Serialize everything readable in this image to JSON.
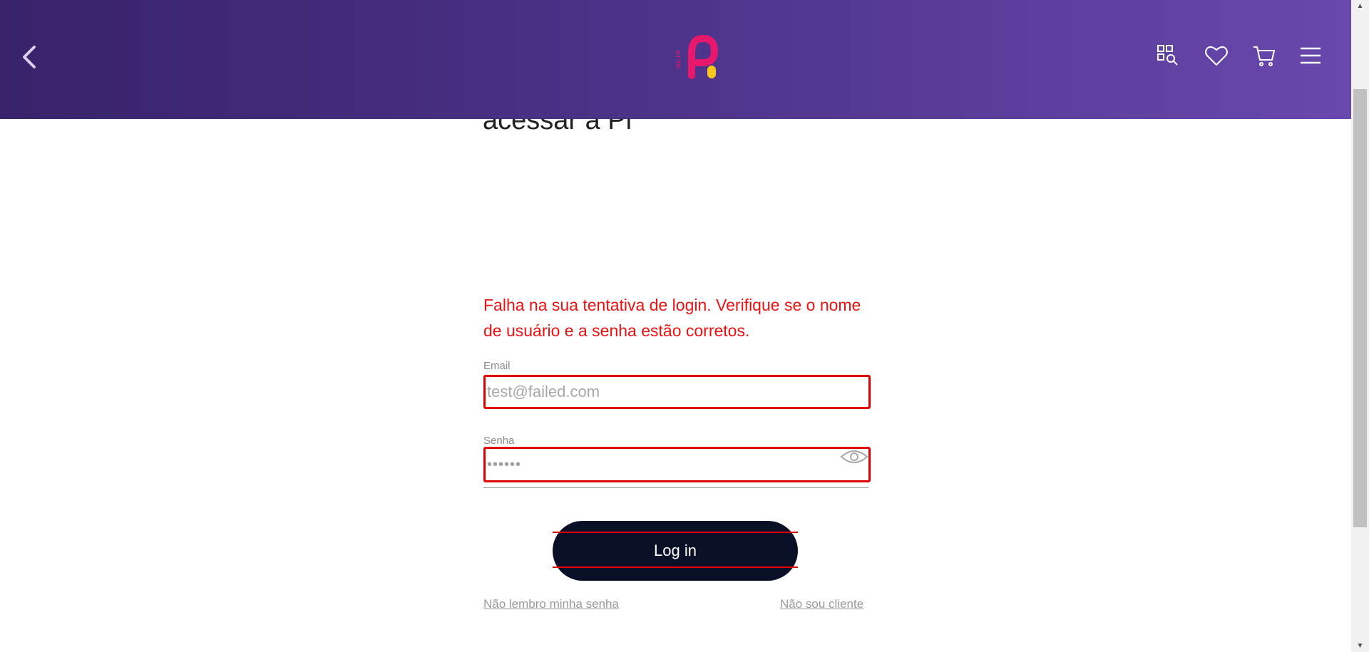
{
  "header": {
    "logo_text": "BETA",
    "icons": [
      "back-arrow-icon",
      "grid-search-icon",
      "heart-icon",
      "cart-icon",
      "hamburger-menu-icon"
    ],
    "gradient_colors": [
      "#38236b",
      "#6948ad"
    ],
    "logo_colors": {
      "p": "#e8186d",
      "dot": "#f7c51e"
    }
  },
  "page": {
    "heading": "acessar a Pi"
  },
  "login": {
    "error_message": "Falha na sua tentativa de login. Verifique se o nome de usuário e a senha estão corretos.",
    "email_label": "Email",
    "email_placeholder": "test@failed.com",
    "password_label": "Senha",
    "password_value": "••••••",
    "login_button": "Log in",
    "forgot_link": "Não lembro minha senha",
    "not_client_link": "Não sou cliente",
    "error_color": "#e00000",
    "button_color": "#0a0f28"
  }
}
